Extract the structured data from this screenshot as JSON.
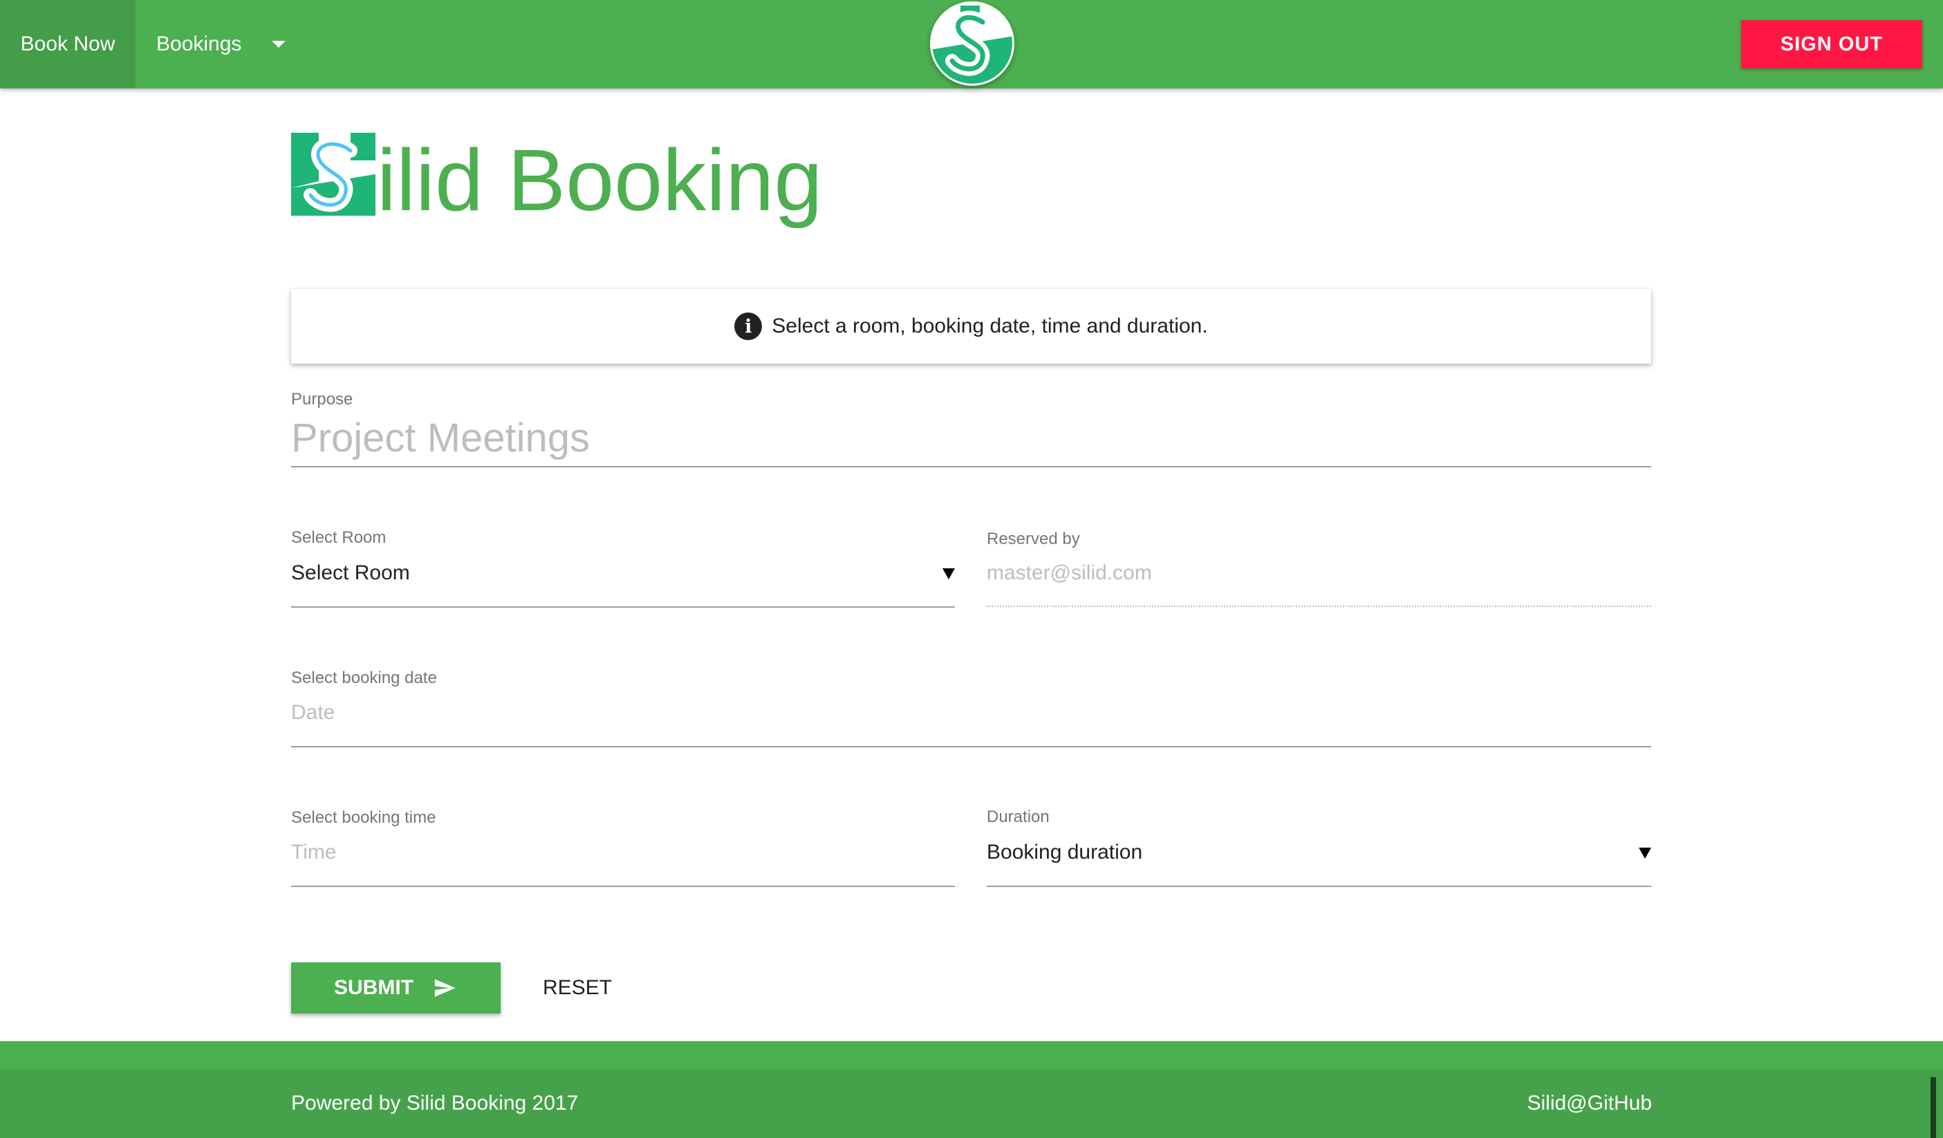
{
  "navbar": {
    "book_now": "Book Now",
    "bookings": "Bookings",
    "sign_out": "SIGN OUT",
    "logo_icon": "silid-logo-icon"
  },
  "brand": {
    "title": "ilid Booking",
    "logo_icon": "silid-s-logo-icon"
  },
  "info": {
    "icon": "info-icon",
    "icon_glyph": "i",
    "message": "Select a room, booking date, time and duration."
  },
  "form": {
    "purpose": {
      "label": "Purpose",
      "placeholder": "Project Meetings"
    },
    "room": {
      "label": "Select Room",
      "value": "Select Room"
    },
    "reserved_by": {
      "label": "Reserved by",
      "value": "master@silid.com"
    },
    "date": {
      "label": "Select booking date",
      "placeholder": "Date"
    },
    "time": {
      "label": "Select booking time",
      "placeholder": "Time"
    },
    "duration": {
      "label": "Duration",
      "value": "Booking duration"
    }
  },
  "actions": {
    "submit": "SUBMIT",
    "reset": "RESET"
  },
  "footer": {
    "powered_by": "Powered by Silid Booking 2017",
    "github": "Silid@GitHub"
  },
  "colors": {
    "primary": "#4caf50",
    "primary_dark": "#449d48",
    "accent": "#ff1744",
    "logo_teal": "#1fb578"
  }
}
